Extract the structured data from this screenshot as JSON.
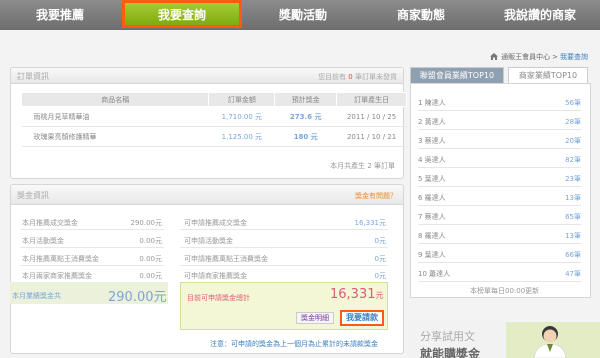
{
  "nav": {
    "items": [
      {
        "label": "我要推薦"
      },
      {
        "label": "我要查詢"
      },
      {
        "label": "獎勵活動"
      },
      {
        "label": "商家動態"
      },
      {
        "label": "我說讚的商家"
      }
    ]
  },
  "breadcrumb": {
    "home": "通販王會員中心",
    "sep": ">",
    "current": "我要查詢"
  },
  "orders": {
    "title": "訂單資訊",
    "note_prefix": "您目前有",
    "note_count": "0",
    "note_suffix": "筆訂單未發貨",
    "headers": [
      "商品名稱",
      "訂單金額",
      "預計獎金",
      "訂單產生日"
    ],
    "rows": [
      {
        "name": "雨桃月見草精華油",
        "amount": "1,710.00 元",
        "bonus": "273.6 元",
        "date": "2011 / 10 / 25"
      },
      {
        "name": "玫瑰果亮顏修護精華",
        "amount": "1,125.00 元",
        "bonus": "180 元",
        "date": "2011 / 10 / 21"
      }
    ],
    "footer": "本月共產生 2 筆訂單"
  },
  "bonus": {
    "title": "獎金資訊",
    "faq": "獎金有問題？",
    "left_rows": [
      {
        "label": "本月推薦成交獎金",
        "value": "290.00元"
      },
      {
        "label": "本月活動獎金",
        "value": "0.00元"
      },
      {
        "label": "本月推薦萬點王消費獎金",
        "value": "0.00元"
      },
      {
        "label": "本月兩家商家推薦獎金",
        "value": "0.00元"
      }
    ],
    "left_total_label": "本月業績獎金共",
    "left_total_value": "290.00元",
    "right_rows": [
      {
        "label": "可申請推薦成交獎金",
        "value": "16,331元"
      },
      {
        "label": "可申請活動獎金",
        "value": "0元"
      },
      {
        "label": "可申請推薦萬點王消費獎金",
        "value": "0元"
      },
      {
        "label": "可申請商家推薦獎金",
        "value": "0元"
      }
    ],
    "right_total_label": "目前可申請獎金總計",
    "right_total_value": "16,331",
    "right_total_unit": "元",
    "detail_button": "獎金明細",
    "claim_button": "我要請款",
    "note": "注意：可申請的獎金為上一個月為止累計的未請款獎金"
  },
  "top10": {
    "tab_active": "聯盟會員業績TOP10",
    "tab_inactive": "商家業績TOP10",
    "rows": [
      {
        "name": "1 陳達人",
        "value": "56筆"
      },
      {
        "name": "2 黃達人",
        "value": "28筆"
      },
      {
        "name": "3 蔡達人",
        "value": "20筆"
      },
      {
        "name": "4 吳達人",
        "value": "82筆"
      },
      {
        "name": "5 葉達人",
        "value": "23筆"
      },
      {
        "name": "6 羅達人",
        "value": "13筆"
      },
      {
        "name": "7 蔡達人",
        "value": "65筆"
      },
      {
        "name": "8 羅達人",
        "value": "13筆"
      },
      {
        "name": "9 葉達人",
        "value": "66筆"
      },
      {
        "name": "10 蕭達人",
        "value": "47筆"
      }
    ],
    "footer": "本榜單每日00:00更新"
  },
  "promo": {
    "line1": "分享試用文",
    "line2": "就能購獎金"
  },
  "colors": {
    "accent_green": "#8ab51c",
    "highlight_orange": "#ff5a12",
    "link_blue": "#3a7fc1",
    "bonus_pink": "#e05a78"
  }
}
